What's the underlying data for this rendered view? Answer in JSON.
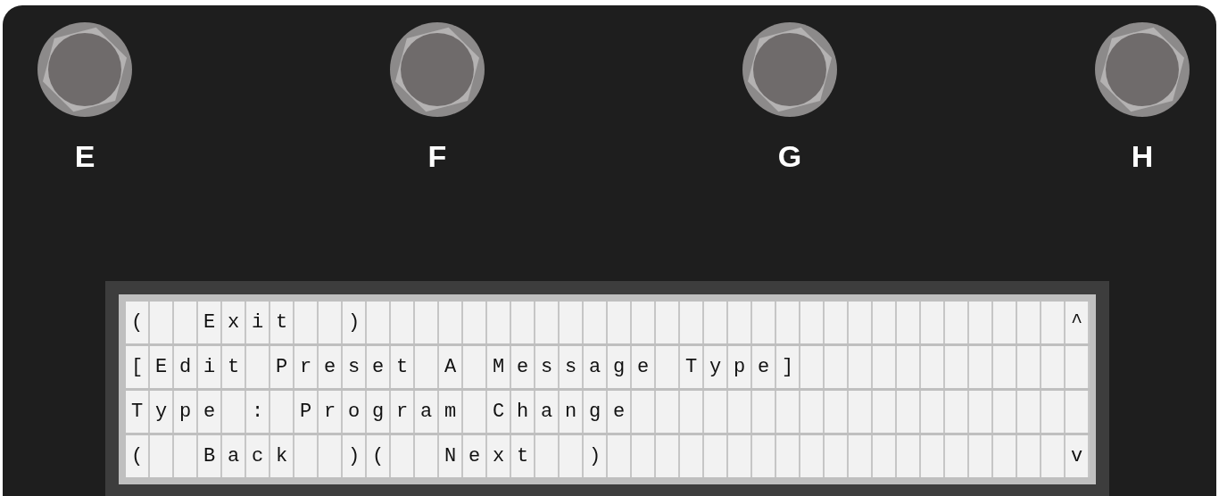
{
  "footswitches": [
    {
      "label": "E"
    },
    {
      "label": "F"
    },
    {
      "label": "G"
    },
    {
      "label": "H"
    }
  ],
  "lcd": {
    "rows": [
      {
        "text": "(  Exit  )",
        "indicator": "^"
      },
      {
        "text": "[Edit Preset A Message Type]"
      },
      {
        "text": "Type : Program Change"
      },
      {
        "text": "(  Back  )(  Next  )",
        "indicator": "v"
      }
    ]
  }
}
